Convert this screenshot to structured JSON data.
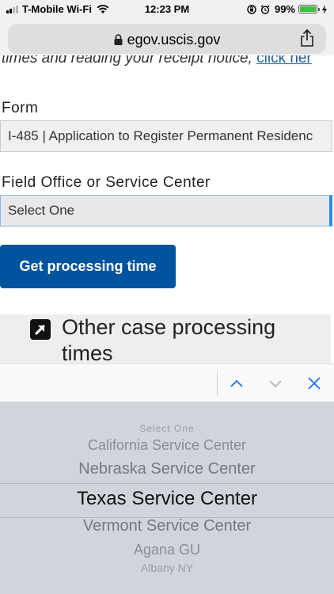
{
  "status_bar": {
    "carrier": "T-Mobile Wi-Fi",
    "time": "12:23 PM",
    "battery": "99%",
    "battery_level": 0.99
  },
  "browser": {
    "url": "egov.uscis.gov"
  },
  "page": {
    "receipt_text": "times and reading your receipt notice, ",
    "receipt_link": "click her",
    "form_label": "Form",
    "form_value": "I-485 | Application to Register Permanent Residenc",
    "office_label": "Field Office or Service Center",
    "office_value": "Select One",
    "submit_label": "Get processing time",
    "other_times_label": "Other case processing times"
  },
  "picker": {
    "options": [
      "Select One",
      "California Service Center",
      "Nebraska Service Center",
      "Texas Service Center",
      "Vermont Service Center",
      "Agana GU",
      "Albany NY"
    ],
    "selected": "Texas Service Center"
  }
}
